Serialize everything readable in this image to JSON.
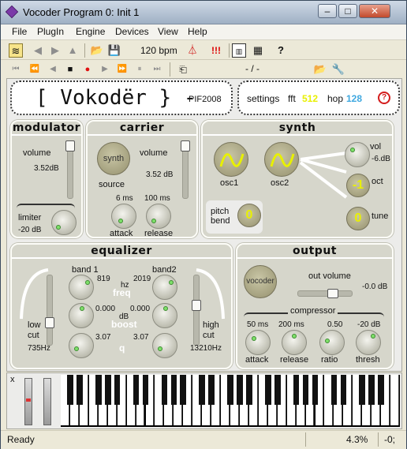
{
  "window": {
    "title": "Vocoder Program 0: Init 1",
    "controls": {
      "minimize": "–",
      "maximize": "□",
      "close": "✕"
    }
  },
  "menu": [
    "File",
    "PlugIn",
    "Engine",
    "Devices",
    "View",
    "Help"
  ],
  "toolbar": {
    "bpm": "120 bpm",
    "alert": "!!!",
    "help": "?",
    "position": "- / -"
  },
  "plugin": {
    "logo": "[ Vokodër } -",
    "brand": "PIF2008",
    "settings_label": "settings",
    "fft_label": "fft",
    "fft_value": "512",
    "hop_label": "hop",
    "hop_value": "128",
    "help_icon": "?"
  },
  "modulator": {
    "title": "modulator",
    "volume_label": "volume",
    "volume_value": "3.52dB",
    "limiter_label": "limiter",
    "limiter_value": "-20 dB",
    "volume_level": 0.92
  },
  "carrier": {
    "title": "carrier",
    "synth_button": "synth",
    "source_label": "source",
    "volume_label": "volume",
    "volume_value": "3.52 dB",
    "attack_value": "6 ms",
    "attack_label": "attack",
    "release_value": "100 ms",
    "release_label": "release",
    "volume_level": 0.92
  },
  "synth": {
    "title": "synth",
    "osc1_label": "osc1",
    "osc2_label": "osc2",
    "pitch_bend_label": "pitch\nbend",
    "pitch_bend_value": "0",
    "vol_label": "vol",
    "vol_value": "-6.dB",
    "oct_label": "oct",
    "oct_value": "-1",
    "tune_label": "tune",
    "tune_value": "0"
  },
  "equalizer": {
    "title": "equalizer",
    "band1_label": "band 1",
    "band2_label": "band2",
    "band1_freq": "819",
    "band2_freq": "2019",
    "hz_label": "hz",
    "freq_label": "freq",
    "band1_boost": "0.000",
    "band2_boost": "0.000",
    "db_label": "dB",
    "boost_label": "boost",
    "band1_q": "3.07",
    "band2_q": "3.07",
    "q_label": "q",
    "low_cut_label": "low\ncut",
    "low_cut_value": "735Hz",
    "high_cut_label": "high\ncut",
    "high_cut_value": "13210Hz"
  },
  "output": {
    "title": "output",
    "vocoder_button": "vocoder",
    "out_volume_label": "out volume",
    "out_volume_value": "-0.0 dB",
    "compressor_label": "compressor",
    "attack_value": "50 ms",
    "attack_label": "attack",
    "release_value": "200 ms",
    "release_label": "release",
    "ratio_value": "0.50",
    "ratio_label": "ratio",
    "thresh_value": "-20 dB",
    "thresh_label": "thresh"
  },
  "keyboard": {
    "close": "x"
  },
  "status": {
    "text": "Ready",
    "cpu": "4.3%",
    "tail": "-0;"
  },
  "colors": {
    "accent_yellow": "#e8f000",
    "knob_dot": "#7ee06a",
    "hop_blue": "#3fa8e0",
    "help_red": "#d41c1c"
  }
}
